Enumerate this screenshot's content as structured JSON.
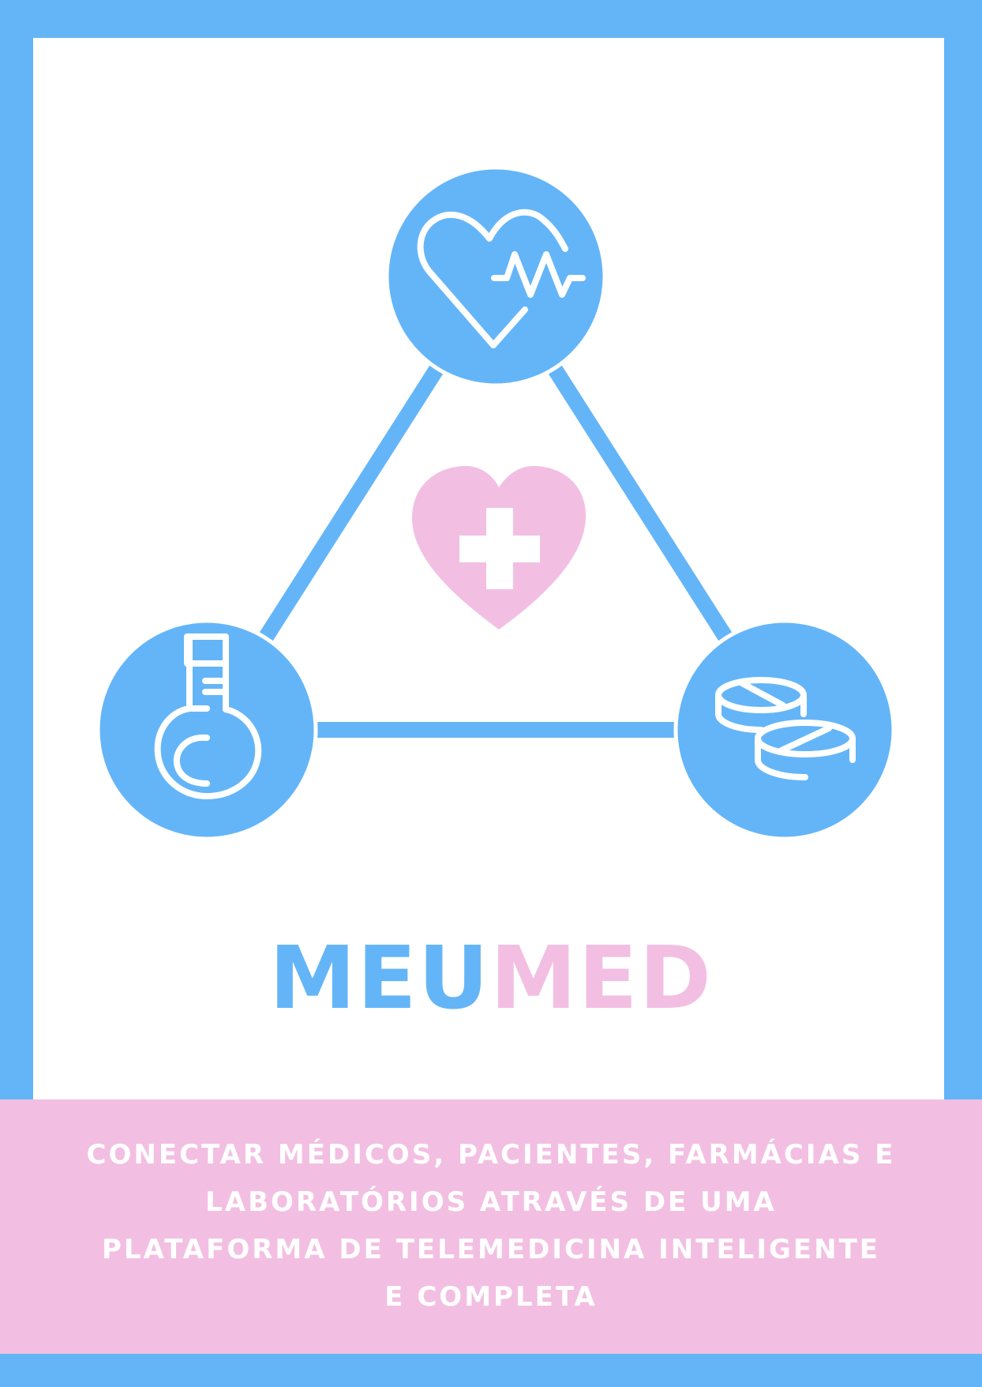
{
  "brand": {
    "part1": "MEU",
    "part2": "MED"
  },
  "tagline": {
    "lines": [
      "CONECTAR MÉDICOS, PACIENTES, FARMÁCIAS E",
      "LABORATÓRIOS ATRAVÉS DE UMA",
      "PLATAFORMA DE TELEMEDICINA INTELIGENTE",
      "E COMPLETA"
    ]
  },
  "colors": {
    "blue": "#64b5f8",
    "pink": "#f2bfe2",
    "white": "#ffffff"
  },
  "icons": {
    "top": "heartbeat-icon",
    "left": "key-icon",
    "right": "pills-icon",
    "center": "medical-heart-icon"
  }
}
